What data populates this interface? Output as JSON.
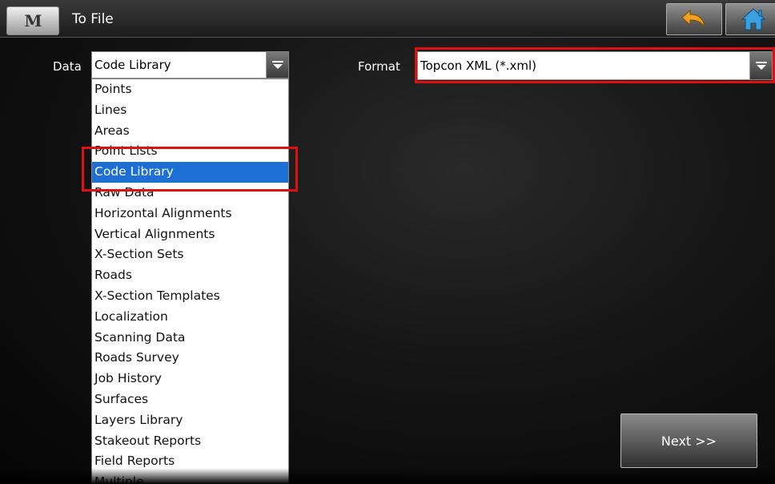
{
  "header": {
    "menu_button_label": "M",
    "title": "To File"
  },
  "form": {
    "data_label": "Data",
    "data_value": "Code Library",
    "format_label": "Format",
    "format_value": "Topcon XML (*.xml)"
  },
  "dropdown": {
    "items": [
      "Points",
      "Lines",
      "Areas",
      "Point Lists",
      "Code Library",
      "Raw Data",
      "Horizontal Alignments",
      "Vertical Alignments",
      "X-Section Sets",
      "Roads",
      "X-Section Templates",
      "Localization",
      "Scanning Data",
      "Roads Survey",
      "Job History",
      "Surfaces",
      "Layers Library",
      "Stakeout Reports",
      "Field Reports",
      "Multiple"
    ],
    "selected": "Code Library"
  },
  "footer": {
    "next_label": "Next >>"
  },
  "colors": {
    "selection": "#1e6fd4",
    "highlight": "#e01010",
    "back_arrow": "#f0a020",
    "home": "#3aa0e0"
  },
  "icons": {
    "back": "back-arrow-icon",
    "home": "home-icon",
    "dropdown": "chevron-down-icon"
  }
}
